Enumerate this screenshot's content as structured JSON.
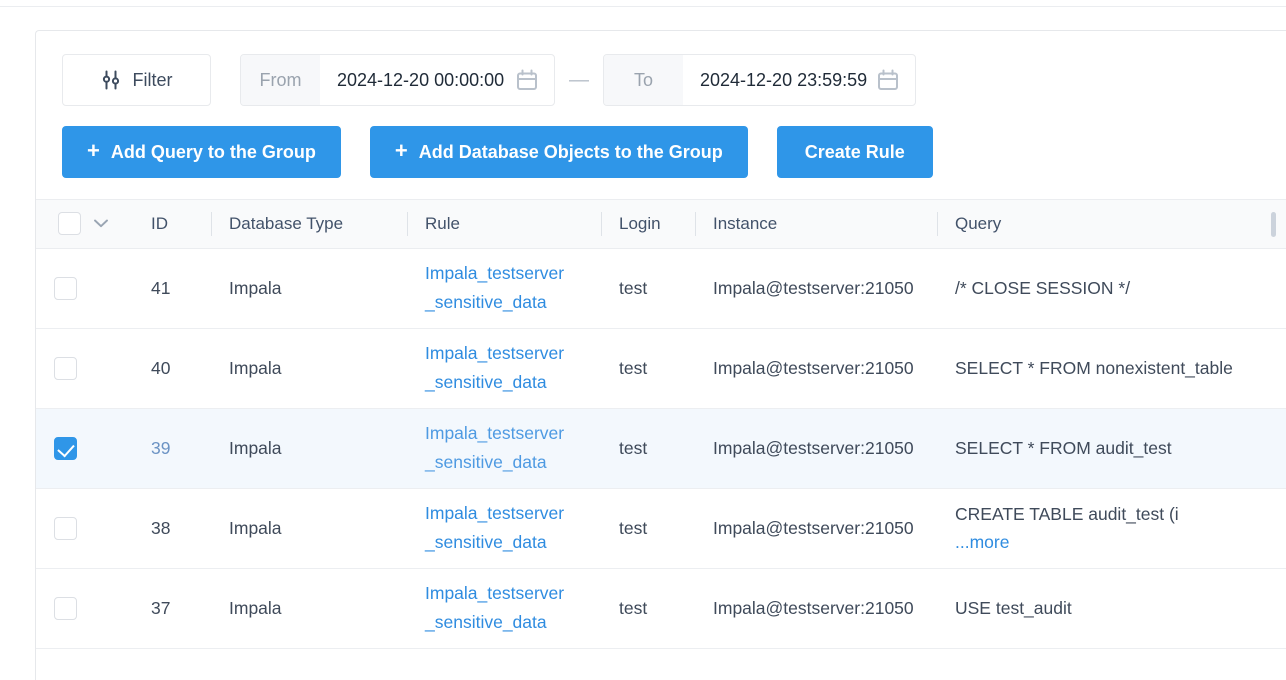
{
  "toolbar": {
    "filter_label": "Filter",
    "filter_icon": "sliders-icon",
    "from_label": "From",
    "from_value": "2024-12-20 00:00:00",
    "from_placeholder": "2024-12-20 00:00:00",
    "to_label": "To",
    "to_value": "2024-12-20 23:59:59",
    "to_placeholder": "2024-12-20 23:59:59",
    "range_separator": "—",
    "calendar_icon": "calendar-icon",
    "buttons": [
      {
        "plus": "+",
        "label": "Add Query to the Group"
      },
      {
        "plus": "+",
        "label": "Add Database Objects to the Group"
      },
      {
        "label": "Create Rule"
      }
    ],
    "accent_color": "#2f96e8"
  },
  "table": {
    "select_all_checked": false,
    "dropdown_icon": "chevron-down-icon",
    "columns": [
      {
        "key": "check",
        "label": ""
      },
      {
        "key": "id",
        "label": "ID"
      },
      {
        "key": "dbtype",
        "label": "Database Type"
      },
      {
        "key": "rule",
        "label": "Rule"
      },
      {
        "key": "login",
        "label": "Login"
      },
      {
        "key": "instance",
        "label": "Instance"
      },
      {
        "key": "query",
        "label": "Query"
      }
    ],
    "rows": [
      {
        "checked": false,
        "id": "41",
        "dbtype": "Impala",
        "rule_line1": "Impala_testserver",
        "rule_line2": "_sensitive_data",
        "login": "test",
        "instance": "Impala@testserver:21050",
        "query": "/* CLOSE SESSION */",
        "more": ""
      },
      {
        "checked": false,
        "id": "40",
        "dbtype": "Impala",
        "rule_line1": "Impala_testserver",
        "rule_line2": "_sensitive_data",
        "login": "test",
        "instance": "Impala@testserver:21050",
        "query": "SELECT * FROM nonexistent_table",
        "more": ""
      },
      {
        "checked": true,
        "id": "39",
        "dbtype": "Impala",
        "rule_line1": "Impala_testserver",
        "rule_line2": "_sensitive_data",
        "login": "test",
        "instance": "Impala@testserver:21050",
        "query": "SELECT * FROM audit_test",
        "more": ""
      },
      {
        "checked": false,
        "id": "38",
        "dbtype": "Impala",
        "rule_line1": "Impala_testserver",
        "rule_line2": "_sensitive_data",
        "login": "test",
        "instance": "Impala@testserver:21050",
        "query": "CREATE TABLE audit_test (i",
        "more": "...more"
      },
      {
        "checked": false,
        "id": "37",
        "dbtype": "Impala",
        "rule_line1": "Impala_testserver",
        "rule_line2": "_sensitive_data",
        "login": "test",
        "instance": "Impala@testserver:21050",
        "query": "USE test_audit",
        "more": ""
      }
    ]
  }
}
